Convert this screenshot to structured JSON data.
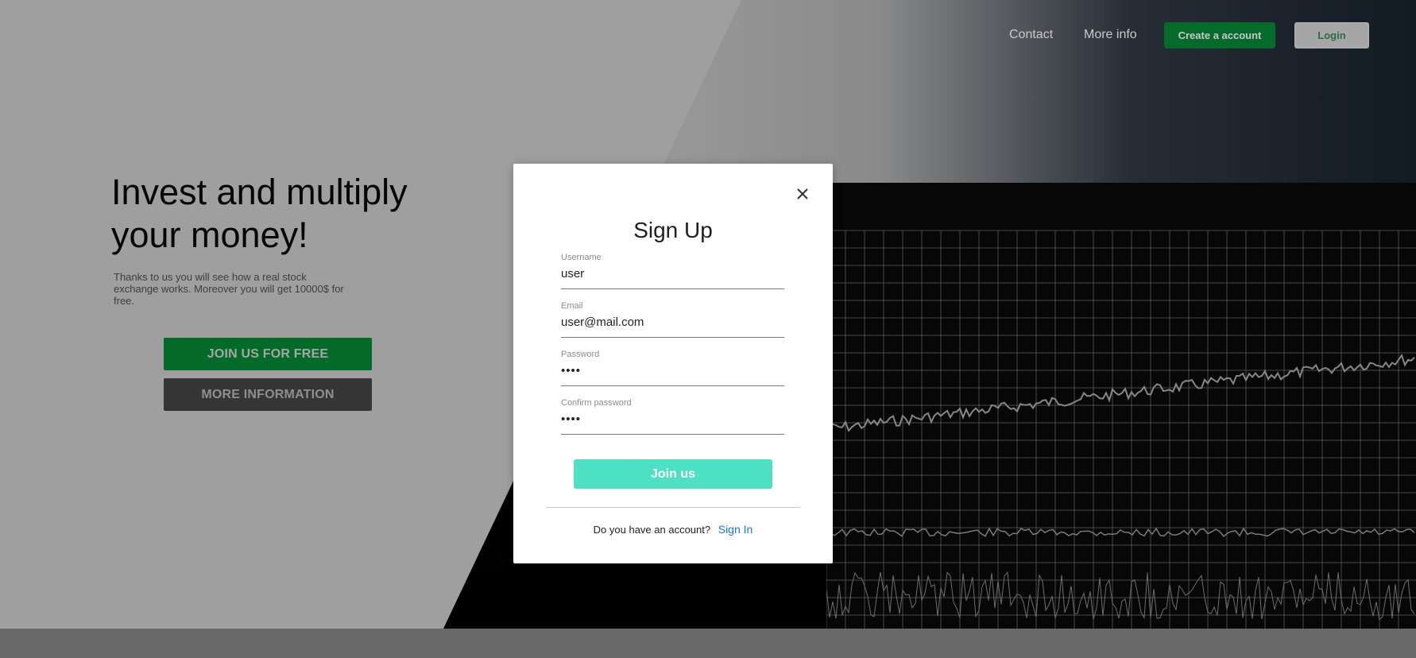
{
  "nav": {
    "contact": "Contact",
    "more_info": "More info",
    "create_account": "Create a account",
    "login": "Login"
  },
  "hero": {
    "title": "Invest and multiply your money!",
    "subtitle": "Thanks to us you will see how a real stock exchange works. Moreover you will get 10000$ for free.",
    "join_button": "JOIN US FOR FREE",
    "more_button": "MORE INFORMATION"
  },
  "modal": {
    "title": "Sign Up",
    "fields": [
      {
        "label": "Username",
        "value": "user",
        "type": "text"
      },
      {
        "label": "Email",
        "value": "user@mail.com",
        "type": "text"
      },
      {
        "label": "Password",
        "value": "••••",
        "type": "password"
      },
      {
        "label": "Confirm password",
        "value": "••••",
        "type": "password"
      }
    ],
    "submit": "Join us",
    "account_prompt": "Do you have an account?",
    "signin_link": "Sign In",
    "close_icon": "close-icon"
  },
  "colors": {
    "brand_green": "#056b2b",
    "accent_teal": "#4ee0c3",
    "link_blue": "#1a73e8"
  }
}
